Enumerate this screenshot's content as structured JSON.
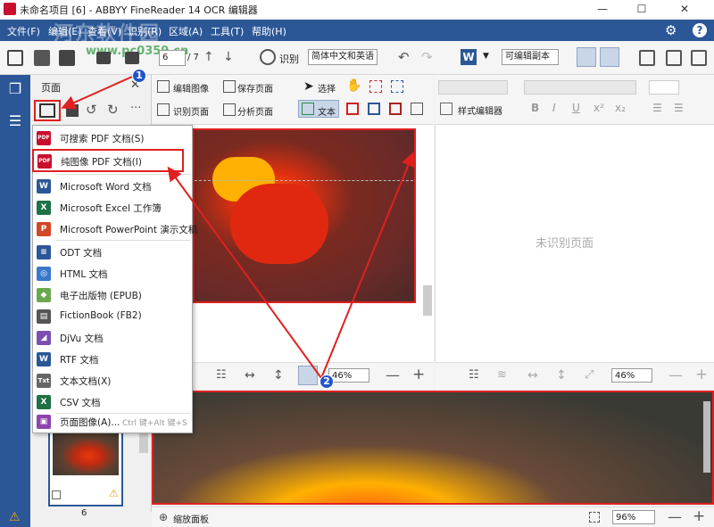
{
  "window": {
    "title": "未命名项目 [6] - ABBYY FineReader 14 OCR 编辑器",
    "controls": {
      "minimize": "—",
      "maximize": "☐",
      "close": "✕"
    }
  },
  "watermark": {
    "line1": "河东软件园",
    "line2": "www.pc0359.cn"
  },
  "menu": [
    "文件(F)",
    "编辑(E)",
    "查看(V)",
    "识别(R)",
    "区域(A)",
    "工具(T)",
    "帮助(H)"
  ],
  "toolbar": {
    "page_current": "6",
    "page_total": "/ 7",
    "recognize_label": "识别",
    "language_value": "简体中文和英语",
    "export_format": "可编辑副本"
  },
  "pages_panel": {
    "title": "页面",
    "thumb_page_number": "6"
  },
  "image_toolbar": {
    "edit_image": "编辑图像",
    "save_page": "保存页面",
    "recognize_page": "识别页面",
    "analyze_page": "分析页面",
    "select": "选择",
    "text": "文本"
  },
  "text_toolbar": {
    "style_editor": "样式编辑器",
    "unrecognized": "未识别页面"
  },
  "zoom": {
    "image_zoom": "46%",
    "text_zoom": "46%",
    "status_zoom": "96%",
    "zoom_panel_label": "缩放面板"
  },
  "dropdown": {
    "items": [
      {
        "label": "可搜索 PDF 文档(S)",
        "icon": "pdf-icon",
        "color": "#c8102e",
        "glyph": "PDF"
      },
      {
        "label": "纯图像 PDF 文档(I)",
        "icon": "pdf-icon",
        "color": "#c8102e",
        "glyph": "PDF"
      },
      {
        "label": "Microsoft Word 文档",
        "icon": "word-icon",
        "color": "#2b5797",
        "glyph": "W"
      },
      {
        "label": "Microsoft Excel 工作簿",
        "icon": "excel-icon",
        "color": "#1e7145",
        "glyph": "X"
      },
      {
        "label": "Microsoft PowerPoint 演示文稿",
        "icon": "powerpoint-icon",
        "color": "#d24726",
        "glyph": "P"
      },
      {
        "label": "ODT 文档",
        "icon": "odt-icon",
        "color": "#2b5797",
        "glyph": "≡"
      },
      {
        "label": "HTML 文档",
        "icon": "html-icon",
        "color": "#3a78c9",
        "glyph": "◎"
      },
      {
        "label": "电子出版物 (EPUB)",
        "icon": "epub-icon",
        "color": "#6aa84f",
        "glyph": "◆"
      },
      {
        "label": "FictionBook (FB2)",
        "icon": "fb2-icon",
        "color": "#555555",
        "glyph": "▤"
      },
      {
        "label": "DjVu 文档",
        "icon": "djvu-icon",
        "color": "#7b4fb0",
        "glyph": "◢"
      },
      {
        "label": "RTF 文档",
        "icon": "rtf-icon",
        "color": "#2b5797",
        "glyph": "W"
      },
      {
        "label": "文本文档(X)",
        "icon": "txt-icon",
        "color": "#666666",
        "glyph": "Txt"
      },
      {
        "label": "CSV 文档",
        "icon": "csv-icon",
        "color": "#1e7145",
        "glyph": "X"
      },
      {
        "label": "页面图像(A)...",
        "icon": "page-image-icon",
        "color": "#8e44ad",
        "glyph": "▣"
      }
    ],
    "shortcut": "Ctrl 键+Alt 键+S"
  },
  "annotations": {
    "badge1": "1",
    "badge2": "2"
  },
  "colors": {
    "accent": "#2b5797",
    "highlight": "#e02020",
    "badge": "#2255cc"
  }
}
